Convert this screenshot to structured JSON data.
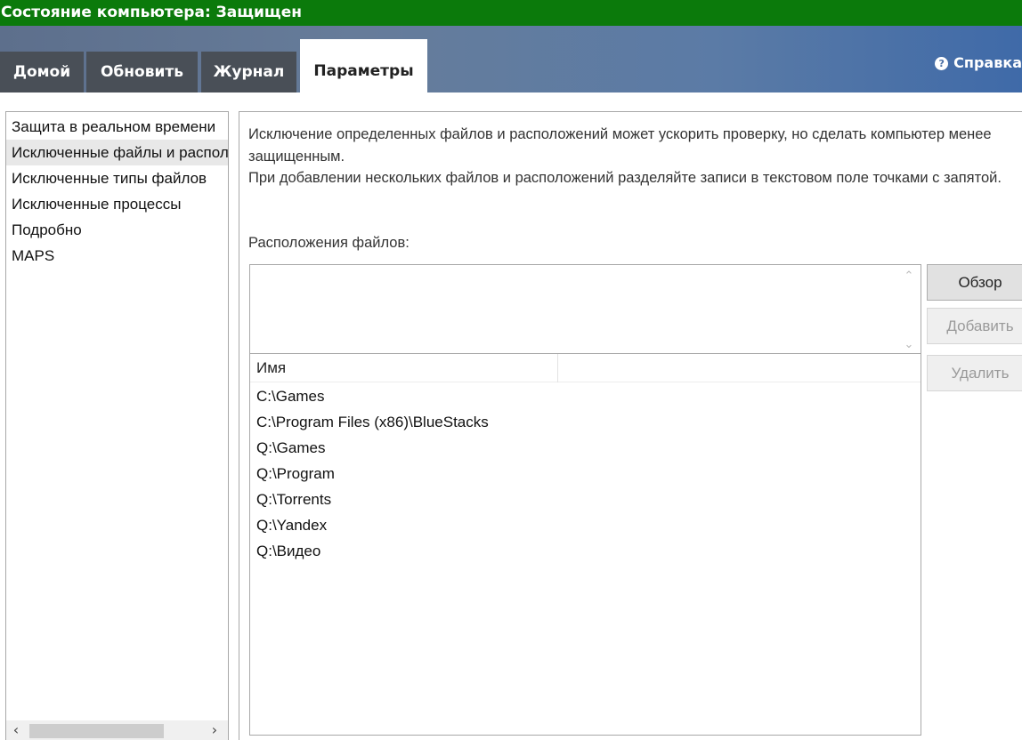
{
  "window": {
    "title": "Состояние компьютера: Защищен"
  },
  "colors": {
    "titlebar": "#0b7a0b",
    "tab_inactive": "#494f57",
    "header_gradient_start": "#5d6f8c",
    "header_gradient_end": "#3f6aa8"
  },
  "tabs": [
    {
      "label": "Домой",
      "active": false
    },
    {
      "label": "Обновить",
      "active": false
    },
    {
      "label": "Журнал",
      "active": false
    },
    {
      "label": "Параметры",
      "active": true
    }
  ],
  "help": {
    "icon": "help-icon",
    "glyph": "?",
    "label": "Справка"
  },
  "sidebar": {
    "items": [
      {
        "label": "Защита в реальном времени",
        "selected": false
      },
      {
        "label": "Исключенные файлы и расположения",
        "selected": true
      },
      {
        "label": "Исключенные типы файлов",
        "selected": false
      },
      {
        "label": "Исключенные процессы",
        "selected": false
      },
      {
        "label": "Подробно",
        "selected": false
      },
      {
        "label": "MAPS",
        "selected": false
      }
    ],
    "scroll_left": "‹",
    "scroll_right": "›"
  },
  "main": {
    "description_1": "Исключение определенных файлов и расположений может ускорить проверку, но сделать компьютер менее защищенным.",
    "description_2": "При добавлении нескольких файлов и расположений разделяйте записи в текстовом поле точками с запятой.",
    "file_locations_label": "Расположения файлов:",
    "input_value": "",
    "table": {
      "columns": [
        "Имя",
        ""
      ],
      "rows": [
        "C:\\Games",
        "C:\\Program Files (x86)\\BlueStacks",
        "Q:\\Games",
        "Q:\\Program",
        "Q:\\Torrents",
        "Q:\\Yandex",
        "Q:\\Видео"
      ]
    },
    "buttons": {
      "browse": "Обзор",
      "add": "Добавить",
      "remove": "Удалить"
    }
  }
}
